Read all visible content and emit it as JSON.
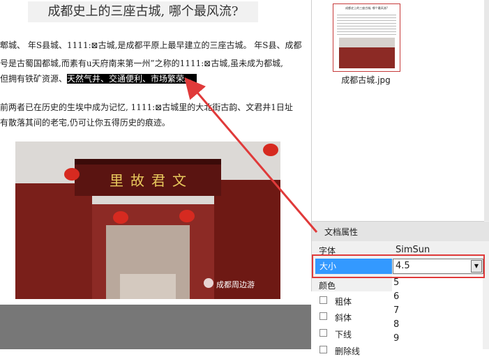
{
  "document": {
    "title": "成都史上的三座古城, 哪个最风流?",
    "line1": "郫城、 年S县城、1111:⊠古城,是成都平原上最早建立的三座古城。 年S县、成都",
    "line2": "号是古蜀国都城,而素有u天府南来第一州”之称的1111:⊠古城,虽未成为都城,",
    "line3_pre": "但拥有铁矿资源、",
    "line3_sel": "天然气井、交通便利、市场繁荣。。",
    "line4": "前两者已在历史的生埃中成为记忆, 1111:⊠古城里的大北街古韵、文君井1日址",
    "line5": "有散落其间的老宅,仍可让你五得历史的痕迹。",
    "photo": {
      "sign_text": "里故君文",
      "watermark": "成都周边游"
    }
  },
  "thumbnails": {
    "thumb_title": "成都史上的三座古城, 哪个最风流?",
    "file_label": "成都古城.jpg"
  },
  "properties": {
    "header": "文档属性",
    "font_key": "字体",
    "font_value": "SimSun",
    "size_key": "大小",
    "size_value": "4.5",
    "size_dropdown_icon": "chevron-down-icon",
    "color_key": "颜色",
    "size_options": [
      "5",
      "6",
      "7",
      "8",
      "9"
    ],
    "checkboxes": [
      "粗体",
      "斜体",
      "下线",
      "删除线"
    ]
  },
  "colors": {
    "highlight_box": "#e03a3a",
    "selection": "#3399ff",
    "arrow": "#e03a3a"
  }
}
